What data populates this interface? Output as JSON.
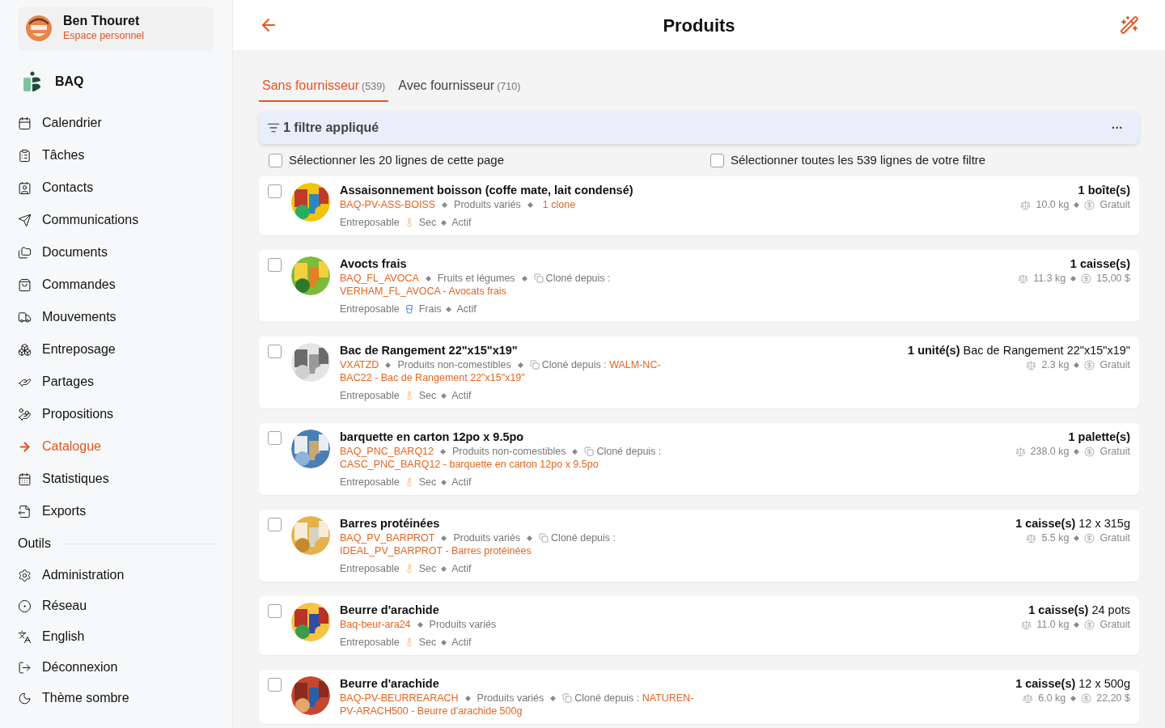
{
  "sidebar": {
    "user": {
      "name": "Ben Thouret",
      "subtitle": "Espace personnel"
    },
    "org": {
      "name": "BAQ"
    },
    "items": [
      {
        "label": "Calendrier",
        "selected": false
      },
      {
        "label": "Tâches",
        "selected": false
      },
      {
        "label": "Contacts",
        "selected": false
      },
      {
        "label": "Communications",
        "selected": false
      },
      {
        "label": "Documents",
        "selected": false
      },
      {
        "label": "Commandes",
        "selected": false
      },
      {
        "label": "Mouvements",
        "selected": false
      },
      {
        "label": "Entreposage",
        "selected": false
      },
      {
        "label": "Partages",
        "selected": false
      },
      {
        "label": "Propositions",
        "selected": false
      },
      {
        "label": "Catalogue",
        "selected": true
      },
      {
        "label": "Statistiques",
        "selected": false
      },
      {
        "label": "Exports",
        "selected": false
      }
    ],
    "section": "Outils",
    "tools": [
      {
        "label": "Administration"
      },
      {
        "label": "Réseau"
      },
      {
        "label": "English"
      },
      {
        "label": "Déconnexion"
      },
      {
        "label": "Thème sombre"
      }
    ]
  },
  "header": {
    "title": "Produits"
  },
  "tabs": [
    {
      "label": "Sans fournisseur",
      "count": "(539)",
      "selected": true
    },
    {
      "label": "Avec fournisseur",
      "count": "(710)",
      "selected": false
    }
  ],
  "filter": {
    "label": "1 filtre appliqué",
    "menu": "···"
  },
  "select_page": {
    "label": "Sélectionner les 20 lignes de cette page",
    "checked": false
  },
  "select_all": {
    "label": "Sélectionner toutes les 539 lignes de votre filtre",
    "checked": false
  },
  "products": [
    {
      "name": "Assaisonnement boisson (coffe mate, lait condensé)",
      "code": "BAQ-PV-ASS-BOISS",
      "category": "Produits variés",
      "clone": {
        "kind": "count",
        "text": "1 clone"
      },
      "storage": "Entreposable",
      "temp": {
        "kind": "dry",
        "label": "Sec"
      },
      "status": "Actif",
      "qty": "1 boîte(s)",
      "weight": "10.0 kg",
      "price": "Gratuit",
      "checked": false
    },
    {
      "name": "Avocts frais",
      "code": "BAQ_FL_AVOCA",
      "category": "Fruits et légumes",
      "clone": {
        "kind": "from",
        "text": "Cloné depuis :",
        "ref": "VERHAM_FL_AVOCA - Avocats frais"
      },
      "storage": "Entreposable",
      "temp": {
        "kind": "fresh",
        "label": "Frais"
      },
      "status": "Actif",
      "qty": "1 caisse(s)",
      "weight": "11.3 kg",
      "price": "15,00 $",
      "checked": false
    },
    {
      "name": "Bac de Rangement 22\"x15\"x19\"",
      "code": "VXATZD",
      "category": "Produits non-comestibles",
      "clone": {
        "kind": "from",
        "text": "Cloné depuis :",
        "ref_start": "WALM-NC-",
        "ref": "BAC22 - Bac de Rangement 22\"x15\"x19\""
      },
      "storage": "Entreposable",
      "temp": {
        "kind": "dry",
        "label": "Sec"
      },
      "status": "Actif",
      "qty": "1 unité(s)",
      "qty_detail": "Bac de Rangement 22\"x15\"x19\"",
      "weight": "2.3 kg",
      "price": "Gratuit",
      "checked": false
    },
    {
      "name": "barquette en carton 12po x 9.5po",
      "code": "BAQ_PNC_BARQ12",
      "category": "Produits non-comestibles",
      "clone": {
        "kind": "from",
        "text": "Cloné depuis :",
        "ref": "CASC_PNC_BARQ12 - barquette en carton 12po x 9.5po"
      },
      "storage": "Entreposable",
      "temp": {
        "kind": "dry",
        "label": "Sec"
      },
      "status": "Actif",
      "qty": "1 palette(s)",
      "weight": "238.0 kg",
      "price": "Gratuit",
      "checked": false
    },
    {
      "name": "Barres protéinées",
      "code": "BAQ_PV_BARPROT",
      "category": "Produits variés",
      "clone": {
        "kind": "from",
        "text": "Cloné depuis :",
        "ref": "IDEAL_PV_BARPROT - Barres protéinées"
      },
      "storage": "Entreposable",
      "temp": {
        "kind": "dry",
        "label": "Sec"
      },
      "status": "Actif",
      "qty": "1 caisse(s)",
      "qty_detail": "12 x 315g",
      "weight": "5.5 kg",
      "price": "Gratuit",
      "checked": false
    },
    {
      "name": "Beurre d'arachide",
      "code": "Baq-beur-ara24",
      "category": "Produits variés",
      "storage": "Entreposable",
      "temp": {
        "kind": "dry",
        "label": "Sec"
      },
      "status": "Actif",
      "qty": "1 caisse(s)",
      "qty_detail": "24 pots",
      "weight": "11.0 kg",
      "price": "Gratuit",
      "checked": false
    },
    {
      "name": "Beurre d'arachide",
      "code": "BAQ-PV-BEURREARACH",
      "category": "Produits variés",
      "clone": {
        "kind": "from",
        "text": "Cloné depuis :",
        "ref_start": "NATUREN-",
        "ref": "PV-ARACH500 - Beurre d'arachide 500g"
      },
      "qty": "1 caisse(s)",
      "qty_detail": "12 x 500g",
      "weight": "6.0 kg",
      "price": "22,20 $",
      "checked": false
    }
  ]
}
